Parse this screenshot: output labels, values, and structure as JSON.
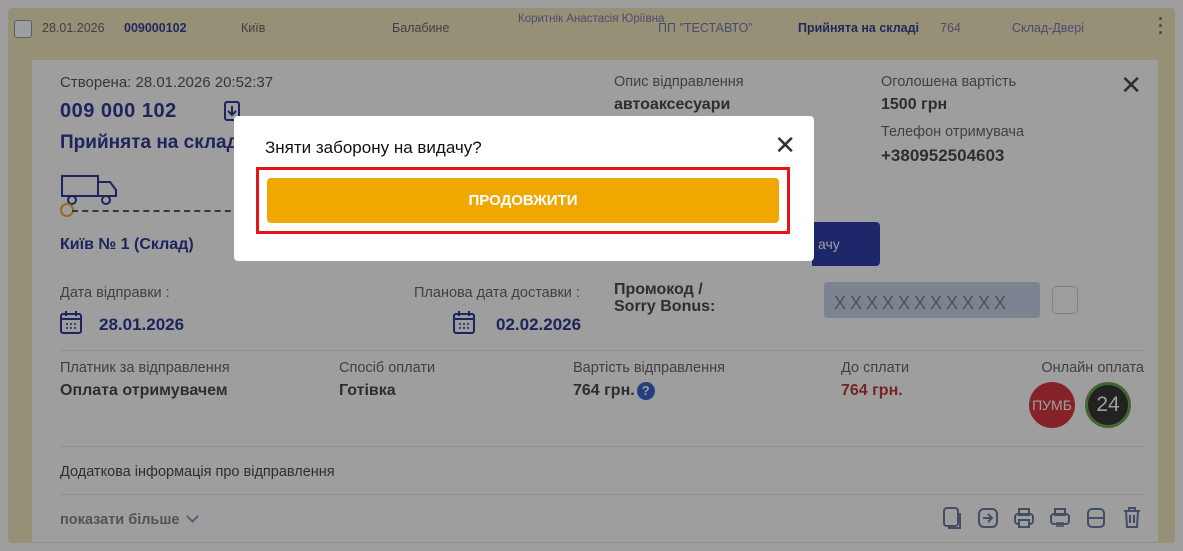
{
  "row": {
    "date": "28.01.2026",
    "number": "009000102",
    "city_from": "Київ",
    "city_to": "Балабине",
    "recipient": "Коритнік Анастасія Юріївна",
    "company": "ПП \"ТЕСТАВТО\"",
    "status": "Прийнята на складі",
    "cost": "764",
    "warehouse": "Склад-Двері"
  },
  "card": {
    "created": "Створена: 28.01.2026 20:52:37",
    "ttn": "009 000 102",
    "status": "Прийнята на склад",
    "route_city": "Київ № 1 (Склад)",
    "description_label": "Опис відправлення",
    "description_value": "автоаксесуари",
    "declared_value_label": "Оголошена вартість",
    "declared_value": "1500 грн",
    "phone_label": "Телефон отримувача",
    "phone_value": "+380952504603",
    "blue_button_label": "ачу",
    "send_date_label": "Дата відправки :",
    "send_date": "28.01.2026",
    "delivery_date_label": "Планова дата доставки :",
    "delivery_date": "02.02.2026",
    "promo_label": "Промокод / Sorry Bonus:",
    "promo_placeholder": "XXXXXXXXXXX",
    "payer_label": "Платник за відправлення",
    "payer_value": "Оплата отримувачем",
    "payment_method_label": "Спосіб оплати",
    "payment_method_value": "Готівка",
    "shipping_cost_label": "Вартість відправлення",
    "shipping_cost_value": "764 грн.",
    "to_pay_label": "До сплати",
    "to_pay_value": "764 грн.",
    "online_payment_label": "Онлайн оплата",
    "bank1": "ПУМБ",
    "bank2": "24",
    "extra_info": "Додаткова інформація про відправлення",
    "show_more": "показати більше"
  },
  "modal": {
    "title": "Зняти заборону на видачу?",
    "continue_label": "ПРОДОВЖИТИ"
  },
  "colors": {
    "accent": "#f0a800",
    "brand_blue": "#17218a",
    "highlight_red": "#e5141b",
    "header_bg": "#f1e6b6"
  }
}
